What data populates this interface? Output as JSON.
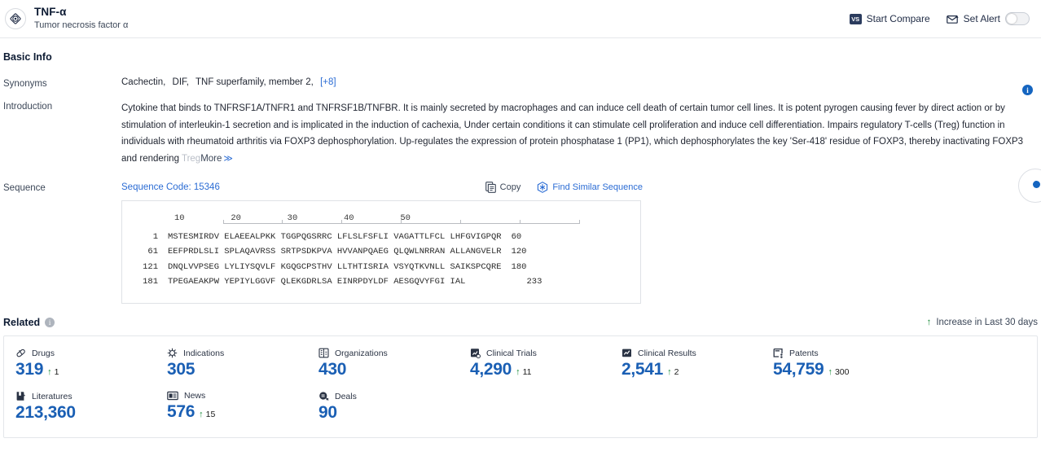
{
  "header": {
    "icon": "target-icon",
    "title": "TNF-α",
    "subtitle": "Tumor necrosis factor α",
    "start_compare_label": "Start Compare",
    "vs_badge": "VS",
    "set_alert_label": "Set Alert",
    "toggle_state": "off"
  },
  "basic_info": {
    "section_title": "Basic Info",
    "synonyms_label": "Synonyms",
    "synonyms": [
      "Cachectin,",
      "DIF,",
      "TNF superfamily, member 2,"
    ],
    "synonyms_more": "[+8]",
    "introduction_label": "Introduction",
    "introduction": "Cytokine that binds to TNFRSF1A/TNFR1 and TNFRSF1B/TNFBR. It is mainly secreted by macrophages and can induce cell death of certain tumor cell lines. It is potent pyrogen causing fever by direct action or by stimulation of interleukin-1 secretion and is implicated in the induction of cachexia, Under certain conditions it can stimulate cell proliferation and induce cell differentiation. Impairs regulatory T-cells (Treg) function in individuals with rheumatoid arthritis via FOXP3 dephosphorylation. Up-regulates the expression of protein phosphatase 1 (PP1), which dephosphorylates the key 'Ser-418' residue of FOXP3, thereby inactivating FOXP3 and rendering ",
    "introduction_trailing": "Treg",
    "more_label": "More",
    "more_chevron": "≫",
    "info_badge": "i"
  },
  "sequence": {
    "label": "Sequence",
    "code_label": "Sequence Code: 15346",
    "copy_label": "Copy",
    "find_similar_label": "Find Similar Sequence",
    "ruler_ticks": [
      "10",
      "20",
      "30",
      "40",
      "50"
    ],
    "rows": [
      {
        "start": "1",
        "body": "MSTESMIRDV ELAEEALPKK TGGPQGSRRC LFLSLFSFLI VAGATTLFCL LHFGVIGPQR",
        "end": "60"
      },
      {
        "start": "61",
        "body": "EEFPRDLSLI SPLAQAVRSS SRTPSDKPVA HVVANPQAEG QLQWLNRRAN ALLANGVELR",
        "end": "120"
      },
      {
        "start": "121",
        "body": "DNQLVVPSEG LYLIYSQVLF KGQGCPSTHV LLTHTISRIA VSYQTKVNLL SAIKSPCQRE",
        "end": "180"
      },
      {
        "start": "181",
        "body": "TPEGAEAKPW YEPIYLGGVF QLEKGDRLSA EINRPDYLDF AESGQVYFGI IAL",
        "end": "233"
      }
    ]
  },
  "related": {
    "title": "Related",
    "info_badge": "i",
    "legend_arrow": "↑",
    "legend_label": "Increase in Last 30 days",
    "cards": [
      {
        "icon": "pill-icon",
        "label": "Drugs",
        "value": "319",
        "delta": "1"
      },
      {
        "icon": "virus-icon",
        "label": "Indications",
        "value": "305",
        "delta": ""
      },
      {
        "icon": "building-icon",
        "label": "Organizations",
        "value": "430",
        "delta": ""
      },
      {
        "icon": "clipboard-chart-icon",
        "label": "Clinical Trials",
        "value": "4,290",
        "delta": "11"
      },
      {
        "icon": "results-chart-icon",
        "label": "Clinical Results",
        "value": "2,541",
        "delta": "2"
      },
      {
        "icon": "patent-icon",
        "label": "Patents",
        "value": "54,759",
        "delta": "300"
      },
      {
        "icon": "book-icon",
        "label": "Literatures",
        "value": "213,360",
        "delta": ""
      },
      {
        "icon": "newspaper-icon",
        "label": "News",
        "value": "576",
        "delta": "15"
      },
      {
        "icon": "deal-icon",
        "label": "Deals",
        "value": "90",
        "delta": ""
      }
    ]
  },
  "colors": {
    "accent_blue": "#1a5fb4",
    "link_blue": "#2b6cd4",
    "increase_green": "#1a8c3a",
    "header_navy": "#0d1b33"
  }
}
